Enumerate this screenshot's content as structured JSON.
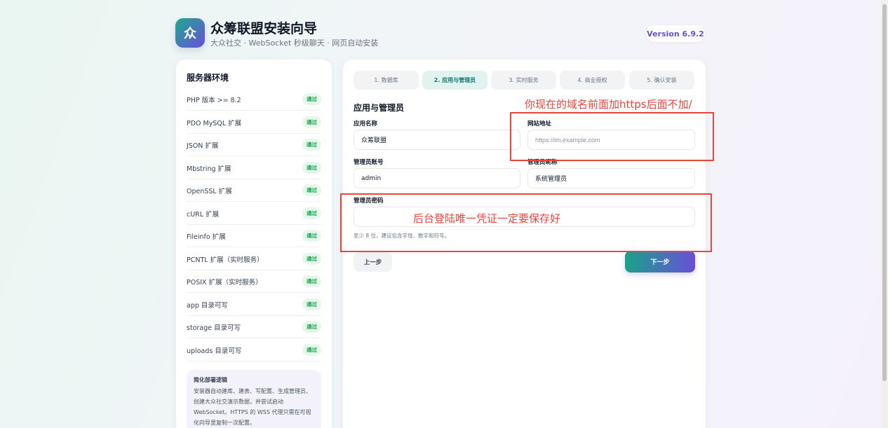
{
  "header": {
    "logo_char": "众",
    "title": "众筹联盟安装向导",
    "subtitle": "大众社交 · WebSocket 秒级聊天 · 网页自动安装",
    "version": "Version 6.9.2"
  },
  "sidebar": {
    "title": "服务器环境",
    "items": [
      {
        "label": "PHP 版本 >= 8.2",
        "status": "通过"
      },
      {
        "label": "PDO MySQL 扩展",
        "status": "通过"
      },
      {
        "label": "JSON 扩展",
        "status": "通过"
      },
      {
        "label": "Mbstring 扩展",
        "status": "通过"
      },
      {
        "label": "OpenSSL 扩展",
        "status": "通过"
      },
      {
        "label": "cURL 扩展",
        "status": "通过"
      },
      {
        "label": "Fileinfo 扩展",
        "status": "通过"
      },
      {
        "label": "PCNTL 扩展（实时服务）",
        "status": "通过"
      },
      {
        "label": "POSIX 扩展（实时服务）",
        "status": "通过"
      },
      {
        "label": "app 目录可写",
        "status": "通过"
      },
      {
        "label": "storage 目录可写",
        "status": "通过"
      },
      {
        "label": "uploads 目录可写",
        "status": "通过"
      }
    ],
    "note_title": "简化部署逻辑",
    "note_body": "安装器自动建库、建表、写配置、生成管理员、创建大众社交演示数据，并尝试启动 WebSocket。HTTPS 的 WSS 代理只需在可视化向导里复制一次配置。"
  },
  "steps": [
    "1. 数据库",
    "2. 应用与管理员",
    "3. 实时服务",
    "4. 商业授权",
    "5. 确认安装"
  ],
  "form": {
    "section_title": "应用与管理员",
    "app_name_label": "应用名称",
    "app_name_value": "众筹联盟",
    "site_url_label": "网站地址",
    "site_url_placeholder": "https://im.example.com",
    "admin_account_label": "管理员账号",
    "admin_account_value": "admin",
    "admin_nick_label": "管理员昵称",
    "admin_nick_value": "系统管理员",
    "admin_pwd_label": "管理员密码",
    "admin_pwd_value": "",
    "pwd_hint": "至少 8 位，建议包含字母、数字和符号。",
    "prev_label": "上一步",
    "next_label": "下一步"
  },
  "annotations": {
    "url_note": "你现在的域名前面加https后面不加/",
    "pwd_note": "后台登陆唯一凭证一定要保存好"
  },
  "colors": {
    "accent_start": "#1aa189",
    "accent_end": "#6a4fd9",
    "pass_green": "#16a34a",
    "annotation_red": "#e8453c"
  }
}
